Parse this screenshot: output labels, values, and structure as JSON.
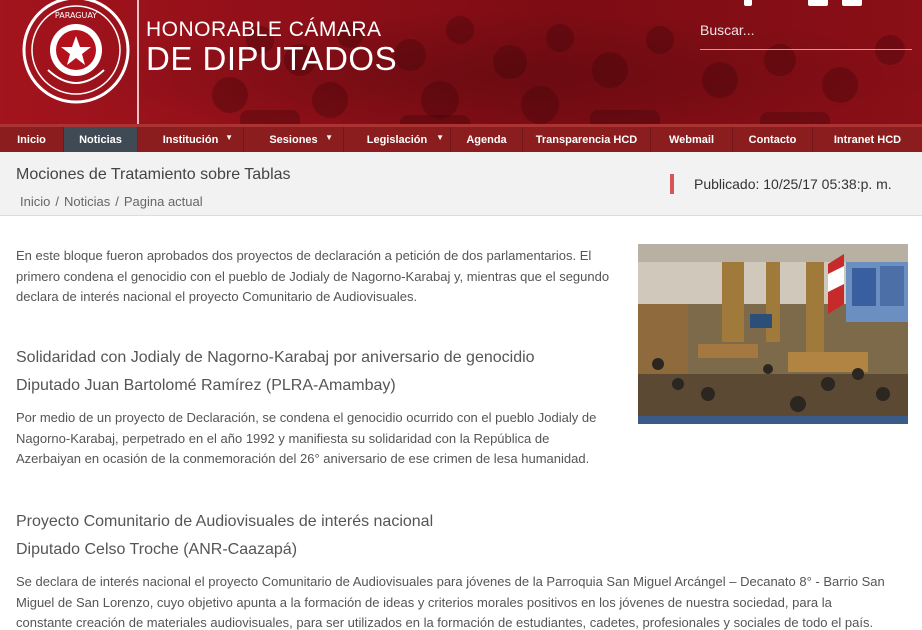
{
  "header": {
    "seal_text": "REPÚBLICA DEL PARAGUAY",
    "brand_line1": "HONORABLE CÁMARA",
    "brand_line2": "DE DIPUTADOS",
    "search_placeholder": "Buscar..."
  },
  "nav": {
    "items": [
      {
        "label": "Inicio"
      },
      {
        "label": "Noticias",
        "active": true
      },
      {
        "label": "Institución"
      },
      {
        "label": "Sesiones"
      },
      {
        "label": "Legislación"
      },
      {
        "label": "Agenda"
      },
      {
        "label": "Transparencia HCD"
      },
      {
        "label": "Webmail"
      },
      {
        "label": "Contacto"
      },
      {
        "label": "Intranet HCD"
      }
    ]
  },
  "titlebar": {
    "title": "Mociones de Tratamiento sobre Tablas",
    "breadcrumb": [
      "Inicio",
      "/",
      "Noticias",
      "/",
      "Pagina actual"
    ],
    "published": "Publicado: 10/25/17 05:38:p. m."
  },
  "article": {
    "intro": [
      "En este bloque fueron aprobados dos proyectos de declaración a petición de dos parlamentarios. El",
      "primero condena el genocidio con el pueblo de Jodialy de Nagorno-Karabaj y, mientras que el segundo",
      "declara de interés nacional el proyecto Comunitario de Audiovisuales."
    ],
    "section1_title": "Solidaridad con Jodialy de Nagorno-Karabaj por aniversario de genocidio",
    "section1_author": "Diputado Juan Bartolomé Ramírez (PLRA-Amambay)",
    "section1_body": [
      "Por medio de un proyecto de Declaración, se condena el genocidio ocurrido con el pueblo Jodialy de",
      "Nagorno-Karabaj, perpetrado en el año 1992 y manifiesta su solidaridad con la República de",
      "Azerbaiyan en ocasión de la conmemoración del 26° aniversario de ese crimen de lesa humanidad."
    ],
    "section2_title": "Proyecto Comunitario de Audiovisuales de interés nacional",
    "section2_author": "Diputado Celso Troche (ANR-Caazapá)",
    "section2_body": [
      "Se declara de interés nacional el proyecto Comunitario de Audiovisuales para jóvenes de la Parroquia San Miguel Arcángel – Decanato 8° - Barrio San",
      "Miguel de San Lorenzo, cuyo objetivo apunta a la formación de ideas y criterios morales positivos en los jóvenes de nuestra sociedad, para la",
      "constante creación de materiales audiovisuales, para ser utilizados en la formación de estudiantes, cadetes, profesionales y sociales de todo el país."
    ]
  }
}
